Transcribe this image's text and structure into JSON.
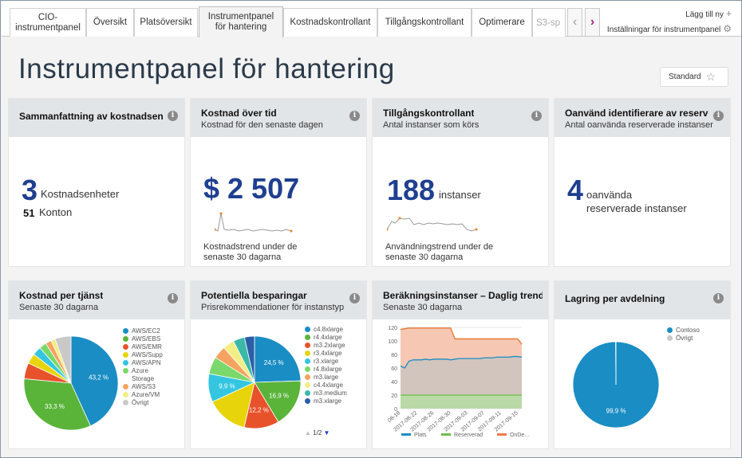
{
  "tabs": [
    {
      "label": "CIO-\ninstrumentpanel"
    },
    {
      "label": "Översikt"
    },
    {
      "label": "Platsöversikt"
    },
    {
      "label": "Instrumentpanel\nför hantering"
    },
    {
      "label": "Kostnadskontrollant"
    },
    {
      "label": "Tillgångskontrollant"
    },
    {
      "label": "Optimerare"
    },
    {
      "label": "S3-sp"
    }
  ],
  "tab_tools": {
    "add_new": "Lägg till ny",
    "settings": "Inställningar för instrumentpanel"
  },
  "page_title": "Instrumentpanel för hantering",
  "standard_button": "Standard",
  "cards": {
    "cost_summary": {
      "title": "Sammanfattning av kostnadsenhet",
      "big": "3",
      "unit": "Kostnadsenheter",
      "accounts_num": "51",
      "accounts_label": "Konton"
    },
    "cost_over_time": {
      "title": "Kostnad över tid",
      "subtitle": "Kostnad för den senaste dagen",
      "big": "$ 2 507",
      "trend": "Kostnadstrend under de senaste 30 dagarna"
    },
    "asset_controller": {
      "title": "Tillgångskontrollant",
      "subtitle": "Antal instanser som körs",
      "big": "188",
      "unit": "instanser",
      "trend": "Användningstrend under de senaste 30 dagarna"
    },
    "unused": {
      "title": "Oanvänd identifierare av reserve…",
      "subtitle": "Antal oanvända reserverade instanser",
      "big": "4",
      "unit": "oanvända\nreserverade instanser"
    },
    "cost_per_service": {
      "title": "Kostnad per tjänst",
      "subtitle": "Senaste 30 dagarna"
    },
    "savings": {
      "title": "Potentiella besparingar",
      "subtitle": "Prisrekommendationer för instanstyp",
      "pager": "1/2"
    },
    "compute": {
      "title": "Beräkningsinstanser – Daglig trend",
      "subtitle": "Senaste 30 dagarna"
    },
    "storage": {
      "title": "Lagring per avdelning"
    }
  },
  "chart_data": [
    {
      "type": "pie",
      "title": "Kostnad per tjänst",
      "categories": [
        "AWS/EC2",
        "AWS/EBS",
        "AWS/EMR",
        "AWS/Supp",
        "AWS/APN",
        "Azure Storage",
        "AWS/S3",
        "Azure/VM",
        "Övrigt"
      ],
      "values": [
        43.2,
        33.3,
        5.5,
        3.5,
        3.0,
        2.5,
        2.0,
        1.5,
        5.5
      ],
      "labels": [
        "43,2 %",
        "33,3 %"
      ],
      "colors": [
        "#1a8dc4",
        "#5ab43a",
        "#e8522a",
        "#e8d40a",
        "#34c6e0",
        "#7bd86a",
        "#f4a460",
        "#f2ee86",
        "#c9c9c9"
      ]
    },
    {
      "type": "pie",
      "title": "Potentiella besparingar",
      "categories": [
        "c4.8xlarge",
        "r4.4xlarge",
        "m3.2xlarge",
        "r3.4xlarge",
        "r3.xlarge",
        "r4.8xlarge",
        "m3.large",
        "c4.4xlarge",
        "m3.medium",
        "m3.xlarge"
      ],
      "values": [
        24.5,
        16.9,
        12.2,
        14.5,
        9.9,
        6.0,
        4.5,
        4.0,
        4.0,
        3.5
      ],
      "labels": [
        "24,5 %",
        "16,9 %",
        "12,2 %",
        "",
        "9,9 %"
      ],
      "colors": [
        "#1a8dc4",
        "#5ab43a",
        "#e8522a",
        "#e8d40a",
        "#34c6e0",
        "#7bd86a",
        "#f4a460",
        "#f2ee86",
        "#3cb8a8",
        "#2a5fa8"
      ]
    },
    {
      "type": "area",
      "title": "Beräkningsinstanser – Daglig trend",
      "x": [
        "08-18",
        "2017-08-22",
        "2017-08-26",
        "2017-08-30",
        "2017-09-03",
        "2017-09-07",
        "2017-09-11",
        "2017-09-15"
      ],
      "ylim": [
        0,
        120
      ],
      "yticks": [
        0,
        20,
        40,
        60,
        80,
        100,
        120
      ],
      "series": [
        {
          "name": "Plats",
          "color": "#1a8dc4",
          "values": [
            63,
            60,
            70,
            72,
            72,
            72,
            73,
            72,
            73,
            73,
            73,
            73,
            72,
            73,
            74,
            74,
            74,
            74,
            74,
            74,
            75,
            75,
            75,
            76,
            76,
            76,
            76,
            77,
            77,
            76
          ]
        },
        {
          "name": "Reserverad",
          "color": "#6cbf4a",
          "values": [
            20,
            20,
            20,
            20,
            20,
            20,
            20,
            20,
            20,
            20,
            20,
            20,
            20,
            20,
            20,
            20,
            20,
            20,
            20,
            20,
            20,
            20,
            20,
            20,
            20,
            20,
            20,
            20,
            20,
            20
          ]
        },
        {
          "name": "OnDe…",
          "color": "#f07a4a",
          "values": [
            117,
            118,
            119,
            119,
            119,
            119,
            119,
            119,
            119,
            119,
            119,
            119,
            119,
            103,
            103,
            103,
            103,
            103,
            103,
            103,
            103,
            103,
            103,
            103,
            103,
            103,
            103,
            103,
            103,
            95
          ]
        }
      ]
    },
    {
      "type": "pie",
      "title": "Lagring per avdelning",
      "categories": [
        "Contoso",
        "Övrigt"
      ],
      "values": [
        99.9,
        0.1
      ],
      "labels": [
        "99,9 %"
      ],
      "colors": [
        "#1a8dc4",
        "#c9c9c9"
      ]
    }
  ]
}
